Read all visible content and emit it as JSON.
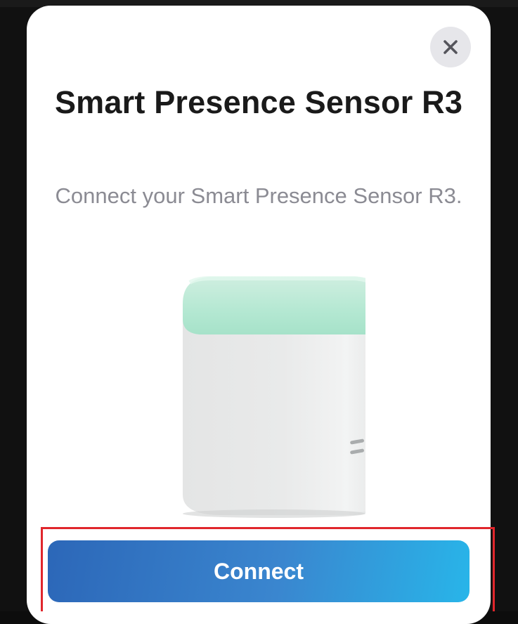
{
  "dialog": {
    "title": "Smart Presence Sensor R3",
    "subtitle": "Connect your Smart Presence Sensor R3.",
    "close_icon": "close-icon",
    "connect_label": "Connect",
    "accent_color": "#3a86cf",
    "highlight_color": "#e0262c"
  }
}
